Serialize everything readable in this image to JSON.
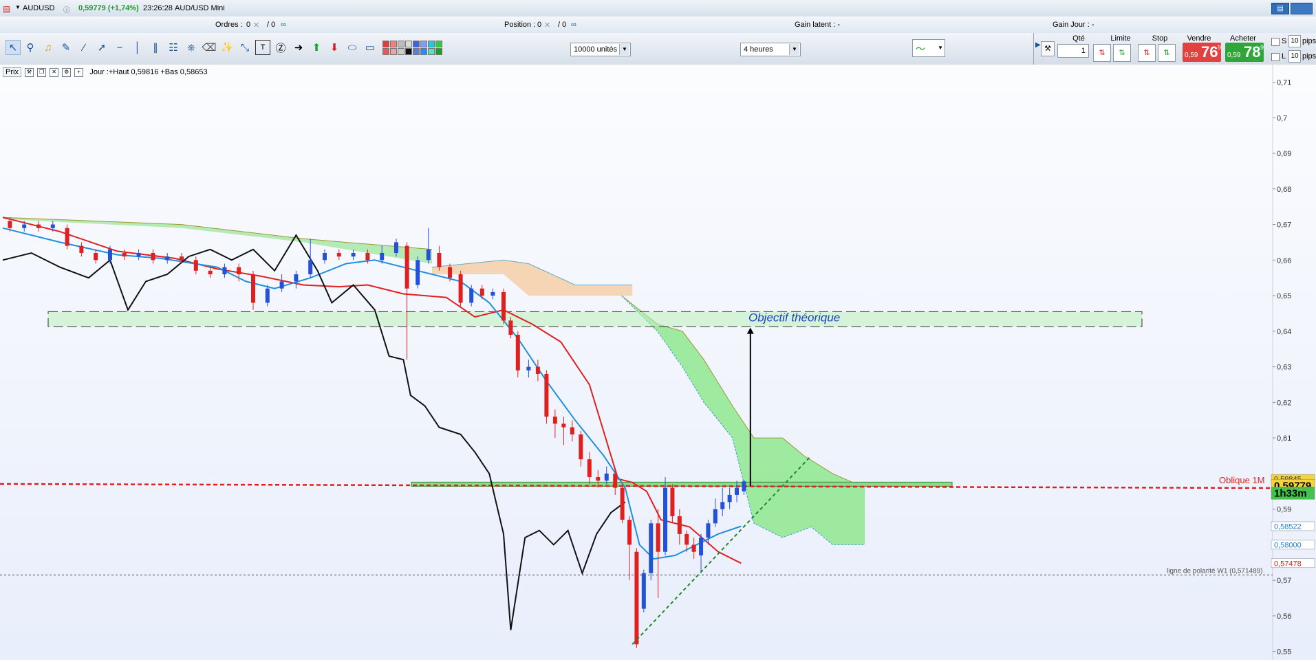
{
  "title_bar": {
    "symbol": "AUDUSD",
    "price_change": "0,59779 (+1,74%)",
    "time": "23:26:28",
    "instrument": "AUD/USD Mini",
    "info_icon": "info-icon",
    "window_icon": "window-restore-icon"
  },
  "status": {
    "orders_label": "Ordres :",
    "orders_value": "0",
    "orders_slash": "/ 0",
    "position_label": "Position :",
    "position_value": "0",
    "position_slash": "/ 0",
    "gain_latent": "Gain latent : -",
    "gain_jour": "Gain Jour : -"
  },
  "toolbar": {
    "units_select": "10000 unités",
    "timeframe_select": "4 heures",
    "colors": [
      "#e23b3b",
      "#e85757",
      "#f08080",
      "#f4a0a0",
      "#bbbbbb",
      "#cccccc",
      "#d9d9d9",
      "#111111",
      "#3b62e2",
      "#5a7be8",
      "#7fa0f0",
      "#1e90ff",
      "#22c7e6",
      "#58e0c0",
      "#2ecc40",
      "#1a9e2a"
    ]
  },
  "trade_panel": {
    "qte_label": "Qté",
    "qte_value": "1",
    "limite_label": "Limite",
    "stop_label": "Stop",
    "vendre_label": "Vendre",
    "acheter_label": "Acheter",
    "sell_small": "0,59",
    "sell_big": "76",
    "sell_sup": "9",
    "buy_small": "0,59",
    "buy_big": "78",
    "buy_sup": "9",
    "s_label": "S",
    "l_label": "L",
    "s_value": "10",
    "l_value": "10",
    "pips": "pips",
    "sell_color": "#e24141",
    "buy_color": "#2fa63a"
  },
  "chart_info": {
    "prix": "Prix",
    "jour": "Jour :+Haut 0,59816 +Bas 0,58653"
  },
  "chart_data": {
    "type": "line",
    "ylim": [
      0.548,
      0.713
    ],
    "y_ticks": [
      {
        "v": 0.71,
        "label": "0,71"
      },
      {
        "v": 0.7,
        "label": "0,7"
      },
      {
        "v": 0.69,
        "label": "0,69"
      },
      {
        "v": 0.68,
        "label": "0,68"
      },
      {
        "v": 0.67,
        "label": "0,67"
      },
      {
        "v": 0.66,
        "label": "0,66"
      },
      {
        "v": 0.65,
        "label": "0,65"
      },
      {
        "v": 0.64,
        "label": "0,64"
      },
      {
        "v": 0.63,
        "label": "0,63"
      },
      {
        "v": 0.62,
        "label": "0,62"
      },
      {
        "v": 0.61,
        "label": "0,61"
      },
      {
        "v": 0.59,
        "label": "0,59"
      },
      {
        "v": 0.57,
        "label": "0,57"
      },
      {
        "v": 0.56,
        "label": "0,56"
      },
      {
        "v": 0.55,
        "label": "0,55"
      }
    ],
    "price_tags": [
      {
        "label": "0,59845",
        "v": 0.5985,
        "color": "#f5d33a",
        "text_color": "#333"
      },
      {
        "label": "0,59779",
        "v": 0.5966,
        "color": "#f5d33a",
        "text_color": "#000",
        "big": true
      },
      {
        "label": "1h33m",
        "v": 0.5945,
        "color": "#44c24a",
        "text_color": "#000",
        "big": true
      },
      {
        "label": "0,58522",
        "v": 0.5852,
        "color": "#ffffff",
        "text_color": "#1e7fd0"
      },
      {
        "label": "0,58000",
        "v": 0.58,
        "color": "#ffffff",
        "text_color": "#1e7fd0"
      },
      {
        "label": "0,57478",
        "v": 0.5748,
        "color": "#ffffff",
        "text_color": "#d42020"
      }
    ],
    "annotations": {
      "objective_label": "Objectif théorique",
      "oblique_label": "Oblique  1M",
      "polarity_label": "ligne de polarité W1 (0,571489)",
      "objective_zone": [
        0.6413,
        0.6455
      ],
      "oblique_level": 0.5965,
      "polarity_level": 0.5715,
      "resistance_zone": [
        0.5965,
        0.5972
      ]
    },
    "series": [
      {
        "color": "#e01f1f",
        "points": [
          [
            0,
            0.672
          ],
          [
            80,
            0.668
          ],
          [
            160,
            0.6625
          ],
          [
            240,
            0.6605
          ],
          [
            300,
            0.6575
          ],
          [
            360,
            0.6555
          ],
          [
            420,
            0.653
          ],
          [
            470,
            0.6525
          ],
          [
            510,
            0.653
          ],
          [
            560,
            0.6505
          ],
          [
            620,
            0.6495
          ],
          [
            660,
            0.644
          ],
          [
            700,
            0.646
          ],
          [
            740,
            0.642
          ],
          [
            780,
            0.637
          ],
          [
            820,
            0.625
          ],
          [
            860,
            0.5985
          ],
          [
            880,
            0.5975
          ],
          [
            900,
            0.595
          ],
          [
            920,
            0.587
          ],
          [
            960,
            0.585
          ],
          [
            1000,
            0.578
          ],
          [
            1032,
            0.5748
          ]
        ]
      },
      {
        "color": "#1e8fe0",
        "points": [
          [
            0,
            0.669
          ],
          [
            80,
            0.665
          ],
          [
            160,
            0.6615
          ],
          [
            220,
            0.6605
          ],
          [
            300,
            0.658
          ],
          [
            340,
            0.654
          ],
          [
            380,
            0.652
          ],
          [
            430,
            0.655
          ],
          [
            480,
            0.659
          ],
          [
            520,
            0.66
          ],
          [
            560,
            0.658
          ],
          [
            600,
            0.656
          ],
          [
            640,
            0.654
          ],
          [
            680,
            0.648
          ],
          [
            720,
            0.638
          ],
          [
            760,
            0.626
          ],
          [
            800,
            0.615
          ],
          [
            840,
            0.605
          ],
          [
            870,
            0.596
          ],
          [
            890,
            0.58
          ],
          [
            910,
            0.576
          ],
          [
            940,
            0.577
          ],
          [
            970,
            0.58
          ],
          [
            1000,
            0.583
          ],
          [
            1032,
            0.5852
          ]
        ]
      },
      {
        "color": "#111111",
        "points": [
          [
            0,
            0.66
          ],
          [
            40,
            0.662
          ],
          [
            80,
            0.658
          ],
          [
            120,
            0.655
          ],
          [
            150,
            0.66
          ],
          [
            175,
            0.646
          ],
          [
            200,
            0.654
          ],
          [
            230,
            0.656
          ],
          [
            260,
            0.661
          ],
          [
            290,
            0.663
          ],
          [
            320,
            0.66
          ],
          [
            350,
            0.663
          ],
          [
            380,
            0.657
          ],
          [
            410,
            0.667
          ],
          [
            440,
            0.657
          ],
          [
            460,
            0.648
          ],
          [
            490,
            0.653
          ],
          [
            520,
            0.646
          ],
          [
            540,
            0.633
          ],
          [
            560,
            0.632
          ],
          [
            570,
            0.622
          ],
          [
            590,
            0.619
          ],
          [
            610,
            0.613
          ],
          [
            640,
            0.611
          ],
          [
            660,
            0.606
          ],
          [
            680,
            0.6
          ],
          [
            700,
            0.583
          ],
          [
            710,
            0.556
          ],
          [
            730,
            0.582
          ],
          [
            750,
            0.584
          ],
          [
            770,
            0.58
          ],
          [
            790,
            0.584
          ],
          [
            810,
            0.572
          ],
          [
            830,
            0.583
          ],
          [
            850,
            0.589
          ],
          [
            870,
            0.592
          ]
        ]
      }
    ],
    "cloud_green_top": [
      [
        0,
        0.672
      ],
      [
        250,
        0.67
      ],
      [
        420,
        0.666
      ],
      [
        600,
        0.663
      ]
    ],
    "cloud_green_bottom": [
      [
        0,
        0.6715
      ],
      [
        250,
        0.669
      ],
      [
        420,
        0.665
      ],
      [
        600,
        0.659
      ]
    ],
    "cloud_orange_top": [
      [
        600,
        0.658
      ],
      [
        700,
        0.66
      ],
      [
        735,
        0.659
      ],
      [
        800,
        0.653
      ],
      [
        880,
        0.653
      ]
    ],
    "cloud_orange_bottom": [
      [
        600,
        0.656
      ],
      [
        700,
        0.656
      ],
      [
        735,
        0.65
      ],
      [
        800,
        0.65
      ],
      [
        880,
        0.65
      ]
    ],
    "cloud_forward_top": [
      [
        865,
        0.65
      ],
      [
        915,
        0.642
      ],
      [
        950,
        0.64
      ],
      [
        980,
        0.632
      ],
      [
        1020,
        0.619
      ],
      [
        1050,
        0.61
      ],
      [
        1090,
        0.61
      ],
      [
        1120,
        0.605
      ],
      [
        1160,
        0.6
      ],
      [
        1205,
        0.596
      ]
    ],
    "cloud_forward_bottom": [
      [
        865,
        0.65
      ],
      [
        915,
        0.64
      ],
      [
        950,
        0.63
      ],
      [
        980,
        0.62
      ],
      [
        1020,
        0.61
      ],
      [
        1050,
        0.586
      ],
      [
        1090,
        0.582
      ],
      [
        1130,
        0.585
      ],
      [
        1160,
        0.58
      ],
      [
        1205,
        0.58
      ]
    ],
    "target_arrow": {
      "x": 1045,
      "from": 0.5965,
      "to": 0.641
    },
    "trendline": {
      "from": [
        880,
        0.552
      ],
      "to": [
        1130,
        0.605
      ]
    },
    "candles": [
      {
        "x": 10,
        "o": 0.671,
        "c": 0.669,
        "h": 0.672,
        "l": 0.668
      },
      {
        "x": 30,
        "o": 0.669,
        "c": 0.67,
        "h": 0.671,
        "l": 0.668
      },
      {
        "x": 50,
        "o": 0.67,
        "c": 0.669,
        "h": 0.671,
        "l": 0.668
      },
      {
        "x": 70,
        "o": 0.669,
        "c": 0.67,
        "h": 0.671,
        "l": 0.668
      },
      {
        "x": 90,
        "o": 0.669,
        "c": 0.664,
        "h": 0.67,
        "l": 0.663
      },
      {
        "x": 110,
        "o": 0.664,
        "c": 0.662,
        "h": 0.665,
        "l": 0.661
      },
      {
        "x": 130,
        "o": 0.662,
        "c": 0.66,
        "h": 0.663,
        "l": 0.659
      },
      {
        "x": 150,
        "o": 0.66,
        "c": 0.663,
        "h": 0.664,
        "l": 0.659
      },
      {
        "x": 170,
        "o": 0.662,
        "c": 0.661,
        "h": 0.663,
        "l": 0.66
      },
      {
        "x": 190,
        "o": 0.661,
        "c": 0.662,
        "h": 0.663,
        "l": 0.66
      },
      {
        "x": 210,
        "o": 0.662,
        "c": 0.66,
        "h": 0.663,
        "l": 0.659
      },
      {
        "x": 230,
        "o": 0.66,
        "c": 0.661,
        "h": 0.662,
        "l": 0.659
      },
      {
        "x": 250,
        "o": 0.661,
        "c": 0.66,
        "h": 0.662,
        "l": 0.659
      },
      {
        "x": 270,
        "o": 0.66,
        "c": 0.657,
        "h": 0.661,
        "l": 0.656
      },
      {
        "x": 290,
        "o": 0.657,
        "c": 0.656,
        "h": 0.658,
        "l": 0.655
      },
      {
        "x": 310,
        "o": 0.656,
        "c": 0.658,
        "h": 0.659,
        "l": 0.655
      },
      {
        "x": 330,
        "o": 0.658,
        "c": 0.656,
        "h": 0.659,
        "l": 0.654
      },
      {
        "x": 350,
        "o": 0.656,
        "c": 0.648,
        "h": 0.657,
        "l": 0.646
      },
      {
        "x": 370,
        "o": 0.648,
        "c": 0.652,
        "h": 0.653,
        "l": 0.647
      },
      {
        "x": 390,
        "o": 0.652,
        "c": 0.654,
        "h": 0.656,
        "l": 0.651
      },
      {
        "x": 410,
        "o": 0.654,
        "c": 0.656,
        "h": 0.657,
        "l": 0.652
      },
      {
        "x": 430,
        "o": 0.656,
        "c": 0.66,
        "h": 0.666,
        "l": 0.655
      },
      {
        "x": 450,
        "o": 0.66,
        "c": 0.662,
        "h": 0.663,
        "l": 0.659
      },
      {
        "x": 470,
        "o": 0.662,
        "c": 0.661,
        "h": 0.663,
        "l": 0.66
      },
      {
        "x": 490,
        "o": 0.661,
        "c": 0.662,
        "h": 0.663,
        "l": 0.66
      },
      {
        "x": 510,
        "o": 0.662,
        "c": 0.66,
        "h": 0.663,
        "l": 0.659
      },
      {
        "x": 530,
        "o": 0.66,
        "c": 0.662,
        "h": 0.664,
        "l": 0.659
      },
      {
        "x": 550,
        "o": 0.662,
        "c": 0.665,
        "h": 0.666,
        "l": 0.661
      },
      {
        "x": 565,
        "o": 0.664,
        "c": 0.652,
        "h": 0.665,
        "l": 0.632
      },
      {
        "x": 580,
        "o": 0.653,
        "c": 0.66,
        "h": 0.661,
        "l": 0.652
      },
      {
        "x": 595,
        "o": 0.66,
        "c": 0.663,
        "h": 0.669,
        "l": 0.659
      },
      {
        "x": 610,
        "o": 0.662,
        "c": 0.658,
        "h": 0.664,
        "l": 0.657
      },
      {
        "x": 625,
        "o": 0.658,
        "c": 0.655,
        "h": 0.659,
        "l": 0.654
      },
      {
        "x": 640,
        "o": 0.656,
        "c": 0.648,
        "h": 0.657,
        "l": 0.647
      },
      {
        "x": 655,
        "o": 0.648,
        "c": 0.652,
        "h": 0.653,
        "l": 0.647
      },
      {
        "x": 670,
        "o": 0.652,
        "c": 0.65,
        "h": 0.653,
        "l": 0.649
      },
      {
        "x": 685,
        "o": 0.65,
        "c": 0.651,
        "h": 0.652,
        "l": 0.649
      },
      {
        "x": 700,
        "o": 0.651,
        "c": 0.643,
        "h": 0.652,
        "l": 0.642
      },
      {
        "x": 710,
        "o": 0.643,
        "c": 0.639,
        "h": 0.644,
        "l": 0.638
      },
      {
        "x": 720,
        "o": 0.639,
        "c": 0.629,
        "h": 0.64,
        "l": 0.627
      },
      {
        "x": 735,
        "o": 0.629,
        "c": 0.63,
        "h": 0.632,
        "l": 0.627
      },
      {
        "x": 748,
        "o": 0.63,
        "c": 0.628,
        "h": 0.632,
        "l": 0.626
      },
      {
        "x": 760,
        "o": 0.628,
        "c": 0.616,
        "h": 0.629,
        "l": 0.614
      },
      {
        "x": 772,
        "o": 0.616,
        "c": 0.614,
        "h": 0.618,
        "l": 0.61
      },
      {
        "x": 784,
        "o": 0.614,
        "c": 0.613,
        "h": 0.616,
        "l": 0.608
      },
      {
        "x": 796,
        "o": 0.613,
        "c": 0.611,
        "h": 0.615,
        "l": 0.609
      },
      {
        "x": 808,
        "o": 0.611,
        "c": 0.604,
        "h": 0.612,
        "l": 0.602
      },
      {
        "x": 820,
        "o": 0.604,
        "c": 0.599,
        "h": 0.606,
        "l": 0.597
      },
      {
        "x": 832,
        "o": 0.599,
        "c": 0.598,
        "h": 0.601,
        "l": 0.596
      },
      {
        "x": 844,
        "o": 0.598,
        "c": 0.6,
        "h": 0.602,
        "l": 0.597
      },
      {
        "x": 856,
        "o": 0.6,
        "c": 0.596,
        "h": 0.601,
        "l": 0.594
      },
      {
        "x": 866,
        "o": 0.596,
        "c": 0.587,
        "h": 0.597,
        "l": 0.586
      },
      {
        "x": 876,
        "o": 0.587,
        "c": 0.58,
        "h": 0.588,
        "l": 0.57
      },
      {
        "x": 886,
        "o": 0.578,
        "c": 0.552,
        "h": 0.579,
        "l": 0.551
      },
      {
        "x": 896,
        "o": 0.562,
        "c": 0.572,
        "h": 0.573,
        "l": 0.561
      },
      {
        "x": 906,
        "o": 0.572,
        "c": 0.586,
        "h": 0.587,
        "l": 0.57
      },
      {
        "x": 916,
        "o": 0.586,
        "c": 0.578,
        "h": 0.59,
        "l": 0.565
      },
      {
        "x": 926,
        "o": 0.578,
        "c": 0.596,
        "h": 0.599,
        "l": 0.577
      },
      {
        "x": 936,
        "o": 0.596,
        "c": 0.588,
        "h": 0.597,
        "l": 0.586
      },
      {
        "x": 946,
        "o": 0.588,
        "c": 0.583,
        "h": 0.59,
        "l": 0.58
      },
      {
        "x": 956,
        "o": 0.583,
        "c": 0.58,
        "h": 0.584,
        "l": 0.578
      },
      {
        "x": 966,
        "o": 0.58,
        "c": 0.578,
        "h": 0.582,
        "l": 0.576
      },
      {
        "x": 976,
        "o": 0.577,
        "c": 0.582,
        "h": 0.583,
        "l": 0.572
      },
      {
        "x": 986,
        "o": 0.582,
        "c": 0.586,
        "h": 0.587,
        "l": 0.58
      },
      {
        "x": 996,
        "o": 0.586,
        "c": 0.59,
        "h": 0.593,
        "l": 0.585
      },
      {
        "x": 1006,
        "o": 0.59,
        "c": 0.592,
        "h": 0.596,
        "l": 0.588
      },
      {
        "x": 1016,
        "o": 0.592,
        "c": 0.594,
        "h": 0.596,
        "l": 0.59
      },
      {
        "x": 1026,
        "o": 0.594,
        "c": 0.596,
        "h": 0.598,
        "l": 0.592
      },
      {
        "x": 1036,
        "o": 0.595,
        "c": 0.5978,
        "h": 0.5982,
        "l": 0.594
      }
    ]
  }
}
